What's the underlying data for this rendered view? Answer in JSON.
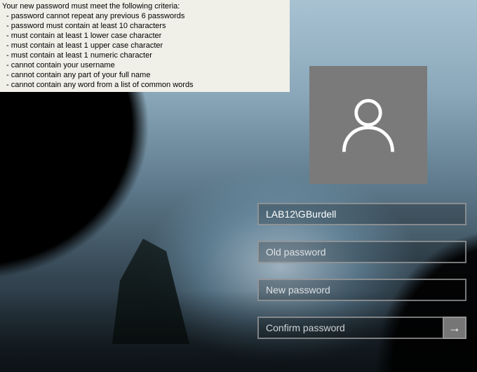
{
  "criteria": {
    "heading": "Your new password must meet the following criteria:",
    "rules": [
      "- password cannot repeat any previous 6 passwords",
      "- password must contain at least 10 characters",
      "- must contain at least 1 lower case character",
      "- must contain at least 1 upper case character",
      "- must contain at least 1 numeric character",
      "- cannot contain your username",
      "- cannot contain any part of your full name",
      "- cannot contain any word from a list of common words"
    ]
  },
  "form": {
    "username_value": "LAB12\\GBurdell",
    "old_password_placeholder": "Old password",
    "new_password_placeholder": "New password",
    "confirm_password_placeholder": "Confirm password",
    "submit_glyph": "→"
  },
  "icons": {
    "user": "user-icon",
    "arrow": "arrow-right-icon"
  }
}
